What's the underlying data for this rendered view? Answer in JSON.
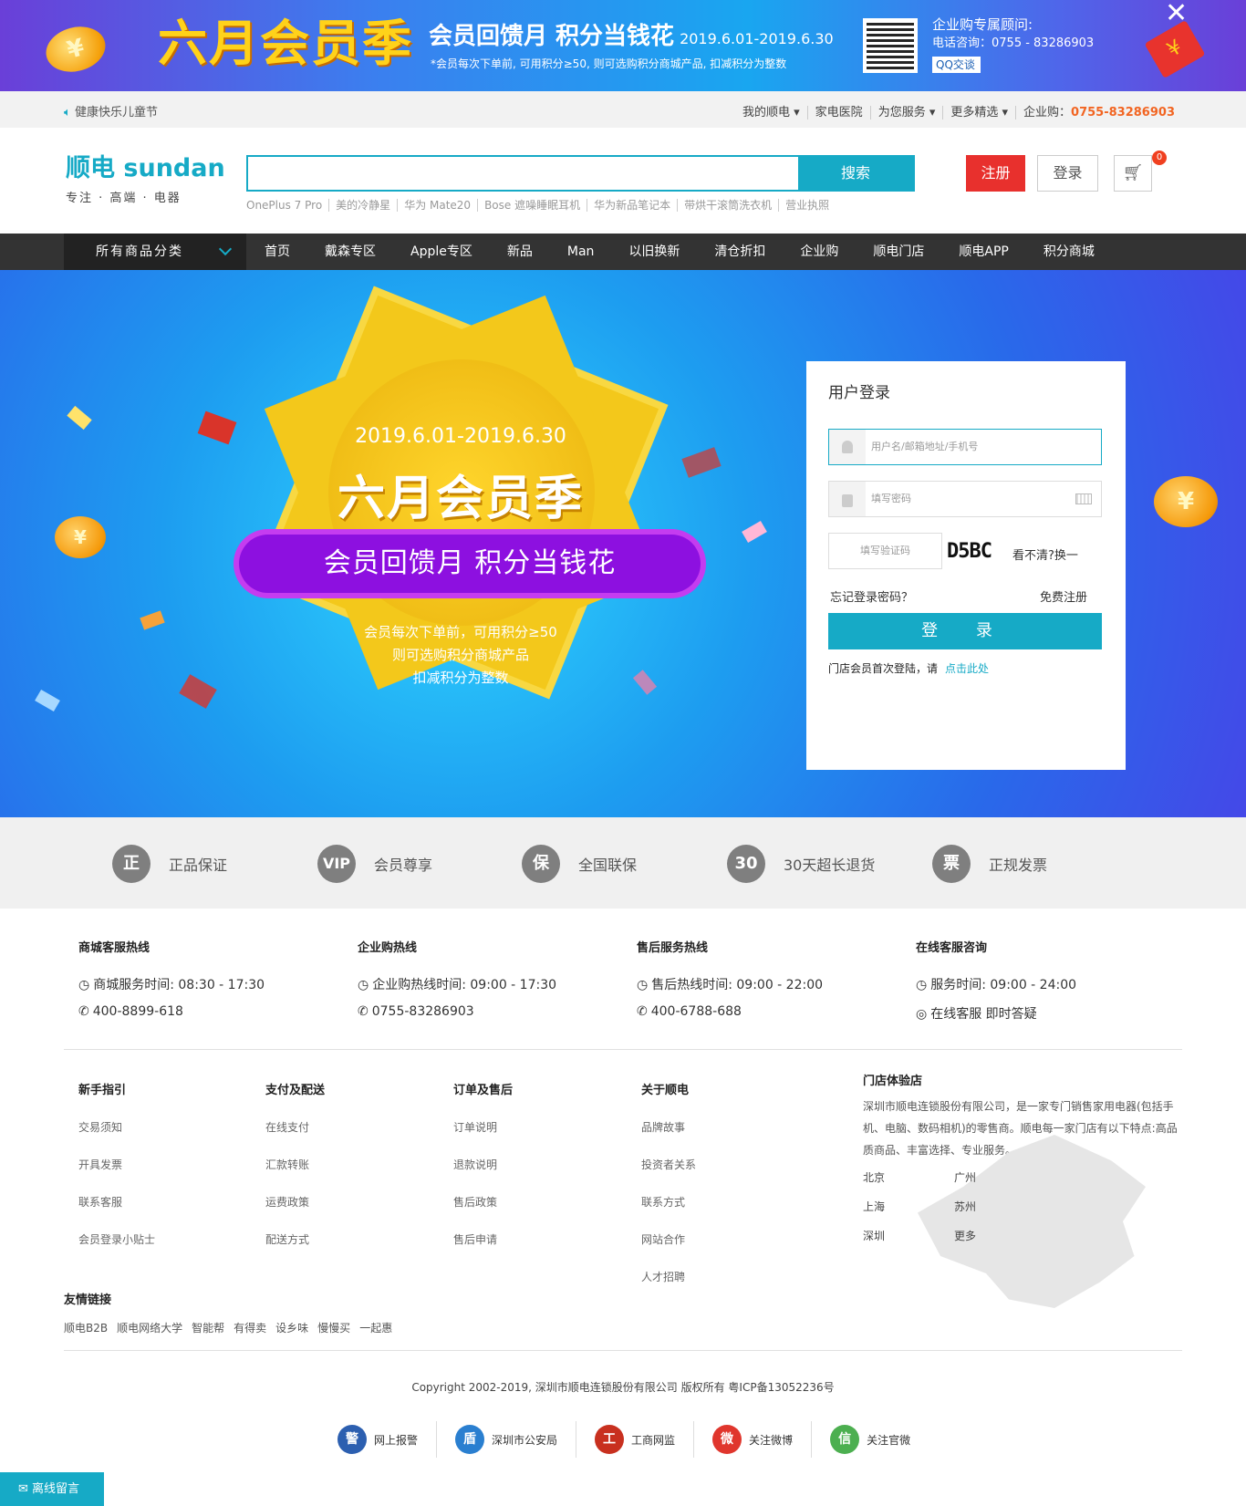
{
  "promo": {
    "headline": "六月会员季",
    "subtitle": "会员回馈月 积分当钱花",
    "dates": "2019.6.01-2019.6.30",
    "note": "*会员每次下单前, 可用积分≥50, 则可选购积分商城产品, 扣减积分为整数",
    "advisor_title": "企业购专属顾问:",
    "advisor_phone": "电话咨询：0755 - 83286903",
    "qq_label": "QQ交谈",
    "coin_symbol": "¥",
    "close": "✕"
  },
  "topbar": {
    "slogan": "健康快乐儿童节",
    "links": [
      "我的顺电 ▾",
      "家电医院",
      "为您服务 ▾",
      "更多精选 ▾"
    ],
    "corp_label": "企业购：",
    "corp_phone": "0755-83286903"
  },
  "header": {
    "logo_name": "顺电 sundan",
    "logo_tagline": "专注 · 高端 · 电器",
    "search_placeholder": "",
    "search_button": "搜索",
    "hot_words": [
      "OnePlus 7 Pro",
      "美的冷静星",
      "华为 Mate20",
      "Bose 遮噪睡眠耳机",
      "华为新品笔记本",
      "带烘干滚筒洗衣机",
      "营业执照"
    ],
    "register": "注册",
    "login": "登录",
    "cart_count": "0"
  },
  "nav": {
    "all_categories": "所有商品分类",
    "items": [
      "首页",
      "戴森专区",
      "Apple专区",
      "新品",
      "Man",
      "以旧换新",
      "清仓折扣",
      "企业购",
      "顺电门店",
      "顺电APP",
      "积分商城"
    ]
  },
  "hero": {
    "dates": "2019.6.01-2019.6.30",
    "title": "六月会员季",
    "ribbon": "会员回馈月  积分当钱花",
    "desc_lines": [
      "会员每次下单前，可用积分≥50",
      "则可选购积分商城产品",
      "扣减积分为整数"
    ]
  },
  "login_panel": {
    "title": "用户登录",
    "username_placeholder": "用户名/邮箱地址/手机号",
    "password_placeholder": "填写密码",
    "captcha_placeholder": "填写验证码",
    "captcha_code": "D5BC",
    "refresh": "看不清?换一",
    "forgot": "忘记登录密码？",
    "free_register": "免费注册",
    "submit": "登 录",
    "note": "门店会员首次登陆，请",
    "note_link": "点击此处"
  },
  "guarantees": [
    {
      "icon": "正",
      "label": "正品保证"
    },
    {
      "icon": "VIP",
      "label": "会员尊享"
    },
    {
      "icon": "保",
      "label": "全国联保"
    },
    {
      "icon": "30",
      "label": "30天超长退货"
    },
    {
      "icon": "票",
      "label": "正规发票"
    }
  ],
  "service": [
    {
      "title": "商城客服热线",
      "time": "商城服务时间: 08:30 - 17:30",
      "contact": "400-8899-618"
    },
    {
      "title": "企业购热线",
      "time": "企业购热线时间: 09:00 - 17:30",
      "contact": "0755-83286903"
    },
    {
      "title": "售后服务热线",
      "time": "售后热线时间: 09:00 - 22:00",
      "contact": "400-6788-688"
    },
    {
      "title": "在线客服咨询",
      "time": "服务时间: 09:00 - 24:00",
      "contact": "在线客服 即时答疑"
    }
  ],
  "footer_cols": [
    {
      "title": "新手指引",
      "items": [
        "交易须知",
        "开具发票",
        "联系客服",
        "会员登录小贴士"
      ]
    },
    {
      "title": "支付及配送",
      "items": [
        "在线支付",
        "汇款转账",
        "运费政策",
        "配送方式"
      ]
    },
    {
      "title": "订单及售后",
      "items": [
        "订单说明",
        "退款说明",
        "售后政策",
        "售后申请"
      ]
    },
    {
      "title": "关于顺电",
      "items": [
        "品牌故事",
        "投资者关系",
        "联系方式",
        "网站合作",
        "人才招聘"
      ]
    }
  ],
  "store": {
    "title": "门店体验店",
    "desc": "深圳市顺电连锁股份有限公司，是一家专门销售家用电器(包括手机、电脑、数码相机)的零售商。顺电每一家门店有以下特点:高品质商品、丰富选择、专业服务。",
    "cities": [
      "北京",
      "广州",
      "上海",
      "苏州",
      "深圳",
      "更多"
    ]
  },
  "friends": {
    "title": "友情链接",
    "links": [
      "顺电B2B",
      "顺电网络大学",
      "智能帮",
      "有得卖",
      "设乡味",
      "慢慢买",
      "一起惠"
    ]
  },
  "copyright": "Copyright 2002-2019, 深圳市顺电连锁股份有限公司 版权所有 粤ICP备13052236号",
  "badges": [
    {
      "label": "网上报警",
      "color": "#2c5fb0"
    },
    {
      "label": "深圳市公安局",
      "color": "#2a7fd0"
    },
    {
      "label": "工商网监",
      "color": "#c8301f"
    },
    {
      "label": "关注微博",
      "color": "#e0362d"
    },
    {
      "label": "关注官微",
      "color": "#4caf50"
    }
  ],
  "message_button": "离线留言"
}
